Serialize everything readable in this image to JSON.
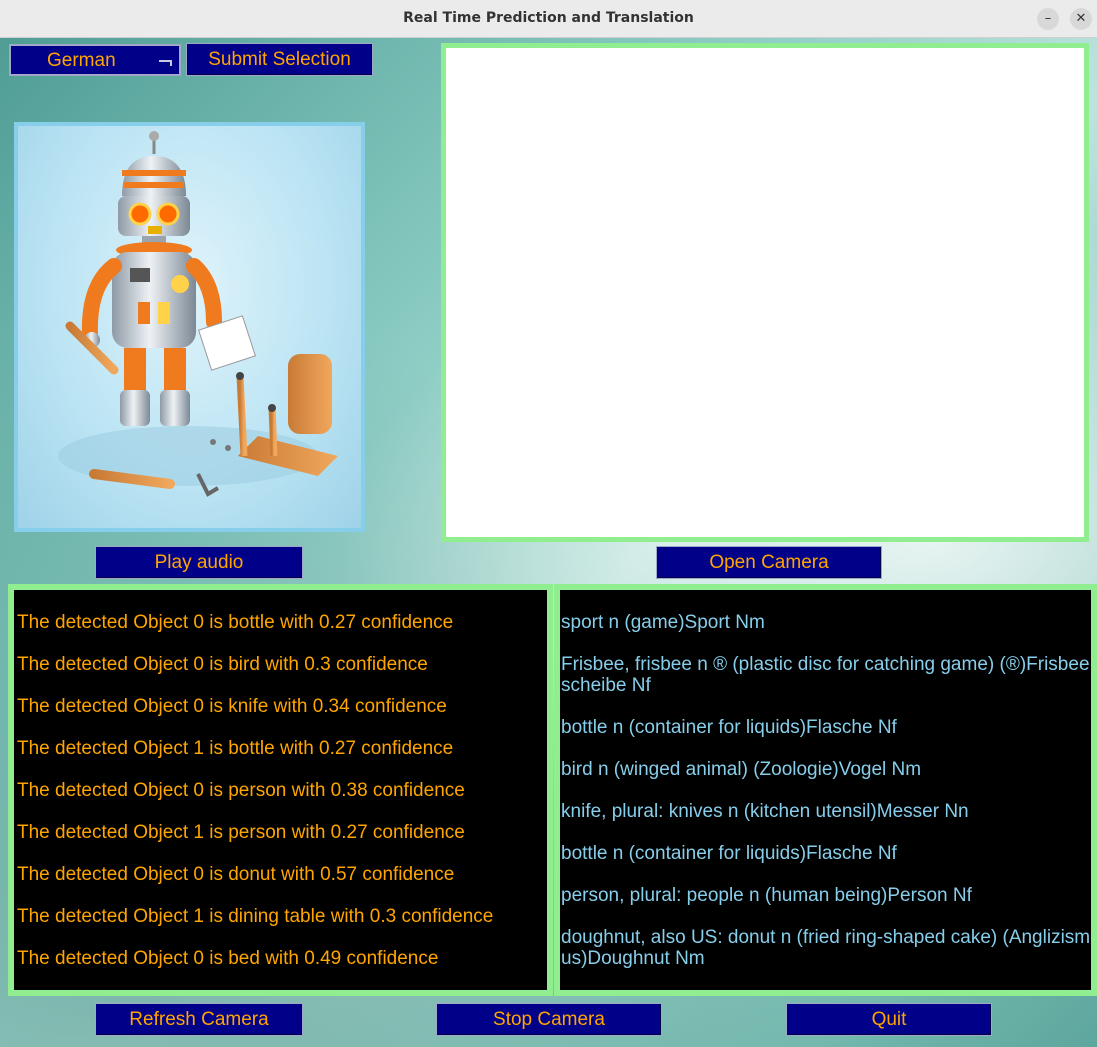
{
  "window": {
    "title": "Real Time Prediction and Translation",
    "minimize_glyph": "–",
    "close_glyph": "✕"
  },
  "toolbar": {
    "language_selected": "German",
    "submit_label": "Submit Selection"
  },
  "buttons": {
    "play_audio": "Play audio",
    "open_camera": "Open Camera",
    "refresh_camera": "Refresh Camera",
    "stop_camera": "Stop Camera",
    "quit": "Quit"
  },
  "detections": [
    "The detected Object 0 is bottle with 0.27 confidence",
    "The detected Object 0 is bird with 0.3 confidence",
    "The detected Object 0 is knife with 0.34 confidence",
    "The detected Object 1 is bottle with 0.27 confidence",
    "The detected Object 0 is person with 0.38 confidence",
    "The detected Object 1 is person with 0.27 confidence",
    "The detected Object 0 is donut with 0.57 confidence",
    "The detected Object 1 is dining table with 0.3 confidence",
    "The detected Object 0 is bed with 0.49 confidence"
  ],
  "translations": [
    "sport n (game)Sport Nm",
    "Frisbee, frisbee n ® (plastic disc for catching game) (®)Frisbeescheibe Nf",
    "bottle n (container for liquids)Flasche Nf",
    "bird n (winged animal) (Zoologie)Vogel Nm",
    "knife, plural: knives n (kitchen utensil)Messer Nn",
    "bottle n (container for liquids)Flasche Nf",
    "person, plural: people n (human being)Person Nf",
    "doughnut, also US: donut n (fried ring-shaped cake) (Anglizismus)Doughnut Nm"
  ],
  "colors": {
    "button_bg": "#000088",
    "button_text": "#ffa500",
    "detection_text": "#ffa500",
    "translation_text": "#87ceeb",
    "panel_border": "#90ee90",
    "image_border": "#87ceeb"
  },
  "icons": {
    "robot_image": "robot-illustration",
    "dropdown_indicator": "option-menu-indicator"
  }
}
